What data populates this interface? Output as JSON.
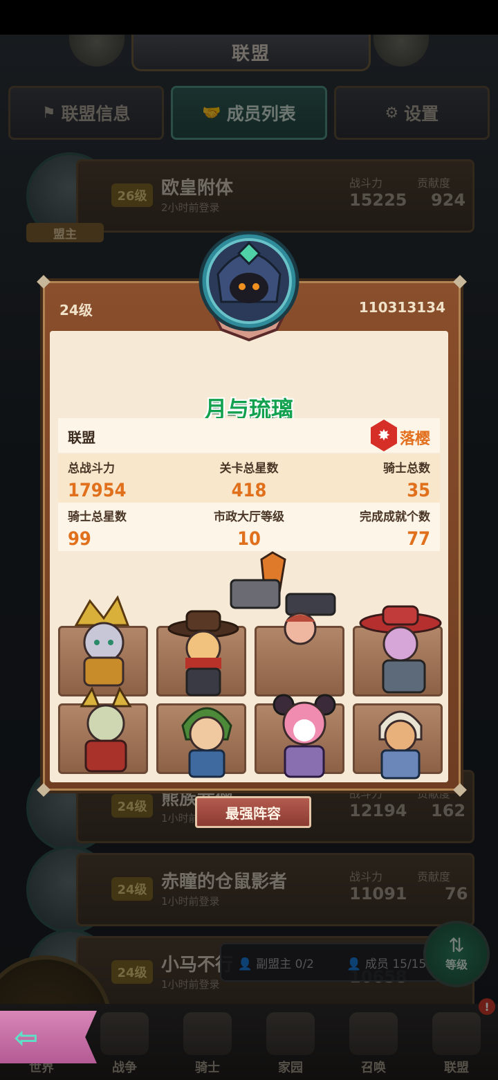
{
  "header": {
    "title": "联盟"
  },
  "tabs": [
    {
      "label": "联盟信息",
      "icon": "flag-icon"
    },
    {
      "label": "成员列表",
      "icon": "handshake-icon",
      "active": true
    },
    {
      "label": "设置",
      "icon": "gear-icon"
    }
  ],
  "members": [
    {
      "level": "26级",
      "name": "欧皇附体",
      "login": "2小时前登录",
      "power_label": "战斗力",
      "power": "15225",
      "contrib_label": "贡献度",
      "contrib": "924",
      "role": "盟主"
    },
    {
      "level": "24级",
      "name": "熊族武僧",
      "login": "1小时前登录",
      "power_label": "战斗力",
      "power": "12194",
      "contrib_label": "贡献度",
      "contrib": "162"
    },
    {
      "level": "24级",
      "name": "赤瞳的仓鼠影者",
      "login": "1小时前登录",
      "power_label": "战斗力",
      "power": "11091",
      "contrib_label": "贡献度",
      "contrib": "76"
    },
    {
      "level": "24级",
      "name": "小马不行",
      "login": "1小时前登录",
      "power": "10658"
    }
  ],
  "footer_info": {
    "vice_label": "副盟主",
    "vice_count": "0/2",
    "member_label": "成员",
    "member_count": "15/15"
  },
  "sort_button": {
    "label": "等级"
  },
  "nav": [
    {
      "label": "世界"
    },
    {
      "label": "战争"
    },
    {
      "label": "骑士"
    },
    {
      "label": "家园"
    },
    {
      "label": "召唤"
    },
    {
      "label": "联盟"
    }
  ],
  "nav_badge": "!",
  "popup": {
    "level": "24级",
    "player_id": "110313134",
    "player_name": "月与琉璃",
    "alliance_label": "联盟",
    "alliance_name": "落樱",
    "stats_row1": [
      {
        "label": "总战斗力",
        "value": "17954"
      },
      {
        "label": "关卡总星数",
        "value": "418"
      },
      {
        "label": "骑士总数",
        "value": "35"
      }
    ],
    "stats_row2": [
      {
        "label": "骑士总星数",
        "value": "99"
      },
      {
        "label": "市政大厅等级",
        "value": "10"
      },
      {
        "label": "完成成就个数",
        "value": "77"
      }
    ],
    "lineup_button": "最强阵容"
  },
  "colors": {
    "name_green": "#12a14e",
    "value_orange": "#e0701c",
    "popup_frame": "#8a4f2c"
  }
}
